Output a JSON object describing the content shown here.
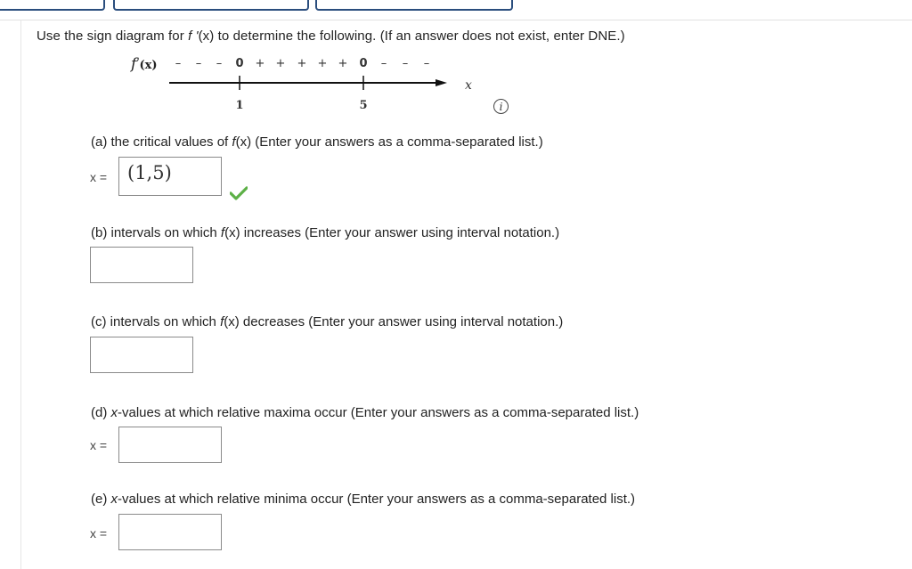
{
  "header": {
    "tabs": [
      "",
      "",
      ""
    ]
  },
  "question": {
    "intro_prefix": "Use the sign diagram for ",
    "intro_fn": "f '",
    "intro_suffix": "(x) to determine the following. (If an answer does not exist, enter DNE.)"
  },
  "sign_diagram": {
    "label_f": "f",
    "label_prime": "′",
    "label_x": "(x)",
    "signs": [
      "–",
      "–",
      "–",
      "0",
      "+",
      "+",
      "+",
      "+",
      "+",
      "0",
      "–",
      "–",
      "–"
    ],
    "tick_labels": [
      "1",
      "5"
    ],
    "axis_var": "x",
    "info_icon_text": "i"
  },
  "parts": {
    "a": {
      "prefix": "(a) the critical values of ",
      "fn": "f",
      "mid": "(x)",
      "suffix": " (Enter your answers as a comma-separated list.)",
      "var_label": "x =",
      "value": "(1,5)",
      "status": "correct"
    },
    "b": {
      "prefix": "(b) intervals on which ",
      "fn": "f",
      "mid": "(x)",
      "suffix": " increases (Enter your answer using interval notation.)",
      "value": ""
    },
    "c": {
      "prefix": "(c) intervals on which ",
      "fn": "f",
      "mid": "(x)",
      "suffix": " decreases (Enter your answer using interval notation.)",
      "value": ""
    },
    "d": {
      "prefix": "(d) ",
      "fn": "x",
      "suffix": "-values at which relative maxima occur (Enter your answers as a comma-separated list.)",
      "var_label": "x =",
      "value": ""
    },
    "e": {
      "prefix": "(e) ",
      "fn": "x",
      "suffix": "-values at which relative minima occur (Enter your answers as a comma-separated list.)",
      "var_label": "x =",
      "value": ""
    }
  },
  "colors": {
    "check": "#5cb046",
    "tab_border": "#2a4d7d"
  }
}
